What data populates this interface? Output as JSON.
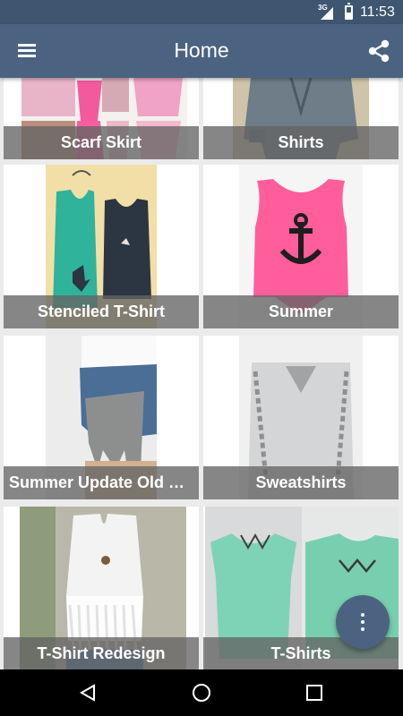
{
  "status_bar": {
    "network": "3G",
    "time": "11:53",
    "icons": [
      "signal-icon",
      "battery-icon"
    ]
  },
  "app_bar": {
    "title": "Home",
    "menu_icon": "hamburger-menu-icon",
    "share_icon": "share-icon"
  },
  "grid": {
    "items": [
      {
        "title": "Scarf Skirt"
      },
      {
        "title": "Shirts"
      },
      {
        "title": "Stenciled T-Shirt"
      },
      {
        "title": "Summer"
      },
      {
        "title": "Summer Update Old D..."
      },
      {
        "title": "Sweatshirts"
      },
      {
        "title": "T-Shirt Redesign"
      },
      {
        "title": "T-Shirts"
      }
    ]
  },
  "fab": {
    "icon": "more-vertical-icon"
  },
  "nav_bar": {
    "icons": [
      "back-icon",
      "home-icon",
      "recents-icon"
    ]
  },
  "colors": {
    "status_bar": "#3e5670",
    "app_bar": "#4b6380",
    "fab": "#4b6380",
    "caption_overlay": "#646464",
    "background": "#ebebeb"
  }
}
